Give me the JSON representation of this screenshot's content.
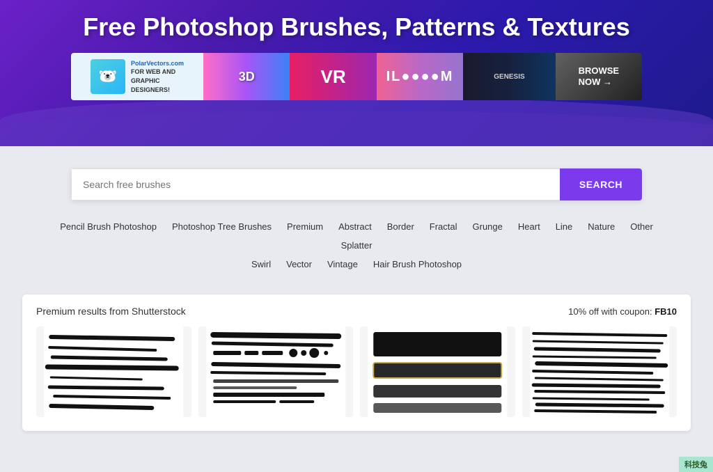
{
  "header": {
    "title": "Free Photoshop Brushes, Patterns & Textures"
  },
  "banner": {
    "polar": {
      "site": "PolarVectors.com",
      "tagline": "FOR WEB AND\nGRAPHIC\nDESIGNERS!"
    },
    "items": [
      {
        "label": "3D",
        "bg": "colorful"
      },
      {
        "label": "VR",
        "bg": "vr"
      },
      {
        "label": "IL●●●●M",
        "bg": "abstract"
      },
      {
        "label": "GENESIS",
        "bg": "dark"
      },
      {
        "label": "BROWSE NOW →",
        "bg": "browse"
      }
    ]
  },
  "search": {
    "placeholder": "Search free brushes",
    "button_label": "SEARCH"
  },
  "tags": {
    "row1": [
      {
        "label": "Pencil Brush Photoshop"
      },
      {
        "label": "Photoshop Tree Brushes"
      },
      {
        "label": "Premium"
      },
      {
        "label": "Abstract"
      },
      {
        "label": "Border"
      },
      {
        "label": "Fractal"
      },
      {
        "label": "Grunge"
      },
      {
        "label": "Heart"
      },
      {
        "label": "Line"
      },
      {
        "label": "Nature"
      },
      {
        "label": "Other"
      },
      {
        "label": "Splatter"
      }
    ],
    "row2": [
      {
        "label": "Swirl"
      },
      {
        "label": "Vector"
      },
      {
        "label": "Vintage"
      },
      {
        "label": "Hair Brush Photoshop"
      }
    ]
  },
  "premium_section": {
    "title": "Premium results from Shutterstock",
    "coupon_prefix": "10% off with coupon: ",
    "coupon_code": "FB10"
  },
  "watermark": {
    "text": "科技兔"
  }
}
